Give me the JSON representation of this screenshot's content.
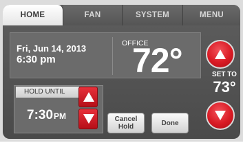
{
  "tabs": [
    {
      "label": "HOME",
      "active": true
    },
    {
      "label": "FAN",
      "active": false
    },
    {
      "label": "SYSTEM",
      "active": false
    },
    {
      "label": "MENU",
      "active": false
    }
  ],
  "status": {
    "date": "Fri, Jun 14, 2013",
    "time": "6:30 pm",
    "zone_label": "OFFICE",
    "current_temp": "72°"
  },
  "hold": {
    "title": "HOLD UNTIL",
    "time": "7:30",
    "period": "PM",
    "up_icon": "triangle-up-icon",
    "down_icon": "triangle-down-icon"
  },
  "actions": {
    "cancel_hold_line1": "Cancel",
    "cancel_hold_line2": "Hold",
    "done": "Done"
  },
  "setpoint": {
    "label": "SET TO",
    "value": "73°"
  },
  "colors": {
    "accent_red": "#d91a24",
    "panel": "#4f4f4f",
    "tab_active": "#ffffff"
  }
}
